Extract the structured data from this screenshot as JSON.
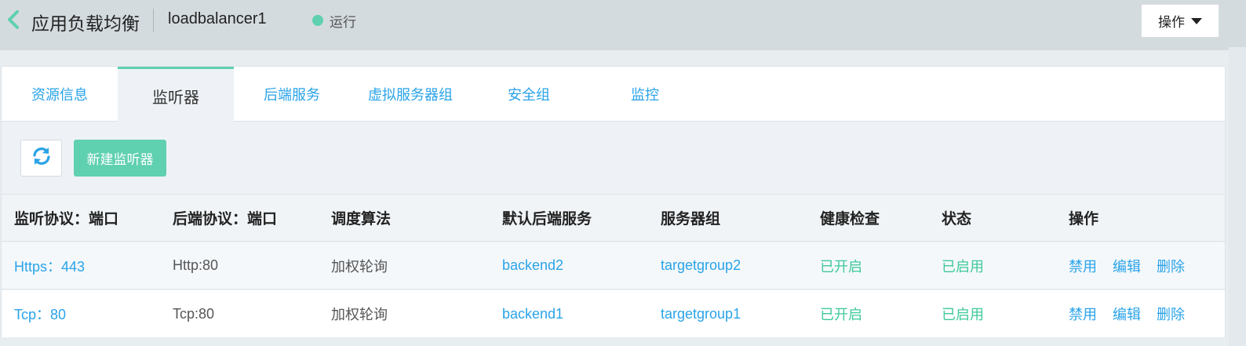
{
  "header": {
    "title": "应用负载均衡",
    "instance_name": "loadbalancer1",
    "status": "运行",
    "action_label": "操作"
  },
  "tabs": [
    {
      "label": "资源信息"
    },
    {
      "label": "监听器"
    },
    {
      "label": "后端服务"
    },
    {
      "label": "虚拟服务器组"
    },
    {
      "label": "安全组"
    },
    {
      "label": "监控"
    }
  ],
  "active_tab": "监听器",
  "toolbar": {
    "new_listener_label": "新建监听器"
  },
  "table": {
    "columns": [
      "监听协议：端口",
      "后端协议：端口",
      "调度算法",
      "默认后端服务",
      "服务器组",
      "健康检查",
      "状态",
      "操作"
    ],
    "rows": [
      {
        "listener": "Https：443",
        "backend_protocol": "Http:80",
        "algorithm": "加权轮询",
        "default_backend": "backend2",
        "server_group": "targetgroup2",
        "health_check": "已开启",
        "status": "已启用",
        "actions": [
          "禁用",
          "编辑",
          "删除"
        ]
      },
      {
        "listener": "Tcp：80",
        "backend_protocol": "Tcp:80",
        "algorithm": "加权轮询",
        "default_backend": "backend1",
        "server_group": "targetgroup1",
        "health_check": "已开启",
        "status": "已启用",
        "actions": [
          "禁用",
          "编辑",
          "删除"
        ]
      }
    ]
  },
  "icons": {
    "back": "chevron-left-icon",
    "refresh": "refresh-icon",
    "dropdown": "caret-down-icon",
    "status": "status-dot-icon"
  },
  "colors": {
    "accent_green": "#5fd0b0",
    "link_blue": "#2aa3e8",
    "status_green": "#3fc99a"
  }
}
